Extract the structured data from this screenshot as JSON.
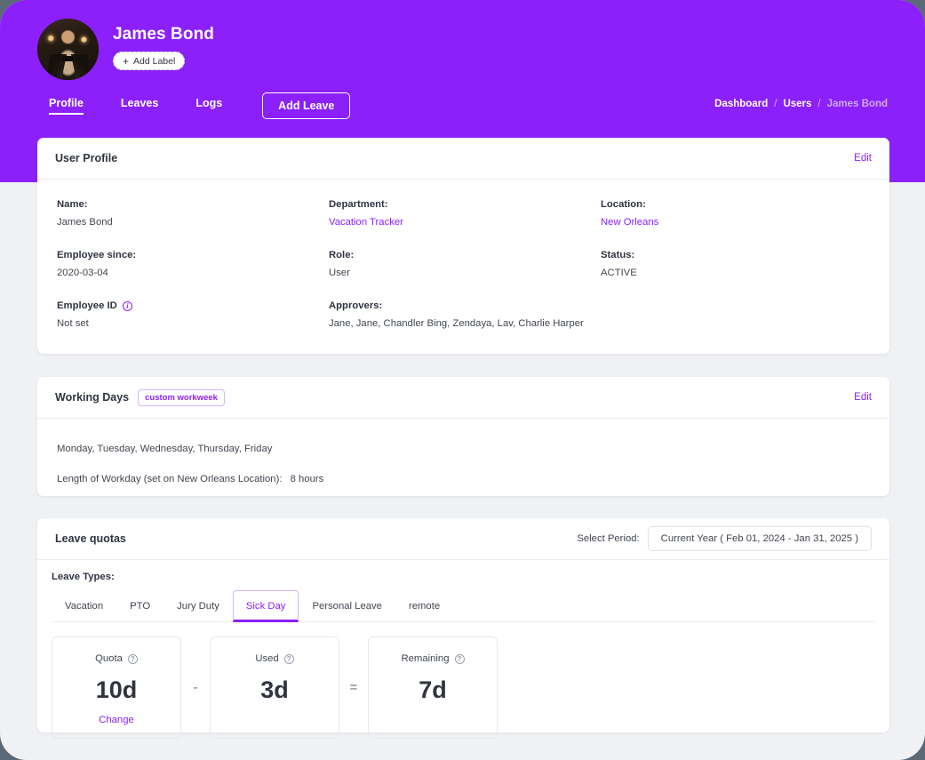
{
  "theme": {
    "brand_purple": "#8b20fb",
    "page_bg": "#f0f1f4",
    "outer_bg": "#5b6876",
    "card_bg": "#ffffff",
    "text_dark": "#2f3440",
    "muted": "#cfaaf6"
  },
  "header": {
    "user_name": "James Bond",
    "add_label_button": "Add Label",
    "add_label_plus": "+",
    "nav": [
      {
        "label": "Profile",
        "active": true
      },
      {
        "label": "Leaves",
        "active": false
      },
      {
        "label": "Logs",
        "active": false
      }
    ],
    "add_leave_button": "Add Leave",
    "breadcrumb": [
      {
        "label": "Dashboard",
        "current": false
      },
      {
        "label": "Users",
        "current": false
      },
      {
        "label": "James Bond",
        "current": true
      }
    ],
    "breadcrumb_separator": "/"
  },
  "profile_card": {
    "title": "User Profile",
    "edit_label": "Edit",
    "fields": {
      "name_label": "Name:",
      "name_value": "James Bond",
      "department_label": "Department:",
      "department_value": "Vacation Tracker",
      "location_label": "Location:",
      "location_value": "New Orleans",
      "employee_since_label": "Employee since:",
      "employee_since_value": "2020-03-04",
      "role_label": "Role:",
      "role_value": "User",
      "status_label": "Status:",
      "status_value": "ACTIVE",
      "employee_id_label": "Employee ID",
      "employee_id_value": "Not set",
      "employee_id_info_icon": "i",
      "approvers_label": "Approvers:",
      "approvers_value": "Jane, Jane, Chandler Bing, Zendaya, Lav, Charlie Harper"
    }
  },
  "working_days_card": {
    "title": "Working Days",
    "badge": "custom workweek",
    "edit_label": "Edit",
    "days": "Monday, Tuesday, Wednesday, Thursday, Friday",
    "workday_length_label": "Length of Workday (set on New Orleans Location):",
    "workday_length_value": "8 hours"
  },
  "leave_quotas_card": {
    "title": "Leave quotas",
    "select_period_label": "Select Period:",
    "select_period_value": "Current Year ( Feb 01, 2024 - Jan 31, 2025 )",
    "leave_types_label": "Leave Types:",
    "leave_types": [
      {
        "label": "Vacation",
        "active": false
      },
      {
        "label": "PTO",
        "active": false
      },
      {
        "label": "Jury Duty",
        "active": false
      },
      {
        "label": "Sick Day",
        "active": true
      },
      {
        "label": "Personal Leave",
        "active": false
      },
      {
        "label": "remote",
        "active": false
      }
    ],
    "boxes": [
      {
        "label": "Quota",
        "info_icon": "?",
        "value": "10d",
        "action": "Change"
      },
      {
        "label": "Used",
        "info_icon": "?",
        "value": "3d",
        "action": ""
      },
      {
        "label": "Remaining",
        "info_icon": "?",
        "value": "7d",
        "action": ""
      }
    ],
    "operators": [
      "-",
      "="
    ]
  }
}
